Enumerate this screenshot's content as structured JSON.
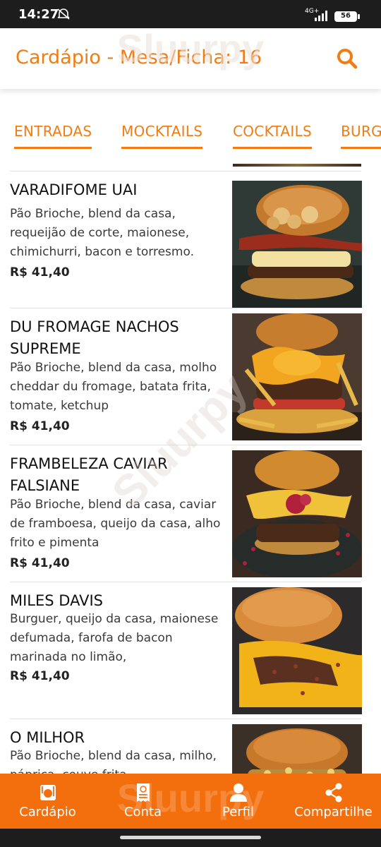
{
  "status_bar": {
    "time": "14:27",
    "network": "4G+",
    "battery": "56"
  },
  "header": {
    "title": "Cardápio - Mesa/Ficha: 16",
    "search_icon": "search-icon"
  },
  "colors": {
    "accent": "#f07c13",
    "nav_background": "#f36f0e"
  },
  "tabs": [
    {
      "label": "ENTRADAS"
    },
    {
      "label": "MOCKTAILS"
    },
    {
      "label": "COCKTAILS"
    },
    {
      "label": "BURGERS"
    }
  ],
  "menu": {
    "items": [
      {
        "name": "VARADIFOME UAI",
        "description": "Pão Brioche, blend da casa, requeijão de corte, maionese, chimichurri, bacon e torresmo.",
        "price": "R$ 41,40"
      },
      {
        "name": "DU FROMAGE NACHOS SUPREME",
        "description": "Pão Brioche, blend da casa, molho cheddar du fromage, batata frita, tomate, ketchup",
        "price": "R$ 41,40"
      },
      {
        "name": "FRAMBELEZA CAVIAR FALSIANE",
        "description": "Pão Brioche, blend da casa, caviar de framboesa, queijo da casa, alho frito e pimenta",
        "price": "R$ 41,40"
      },
      {
        "name": "MILES DAVIS",
        "description": "Burguer, queijo da casa, maionese defumada, farofa de bacon marinada no limão,",
        "price": "R$ 41,40"
      },
      {
        "name": "O MILHOR",
        "description": "Pão Brioche, blend da casa, milho, páprica, couve frita",
        "price": ""
      }
    ]
  },
  "bottom_nav": [
    {
      "label": "Cardápio",
      "icon": "menu-dish-icon"
    },
    {
      "label": "Conta",
      "icon": "bill-icon"
    },
    {
      "label": "Perfil",
      "icon": "user-icon"
    },
    {
      "label": "Compartilhe",
      "icon": "share-icon"
    }
  ],
  "watermark": "Sluurpy"
}
